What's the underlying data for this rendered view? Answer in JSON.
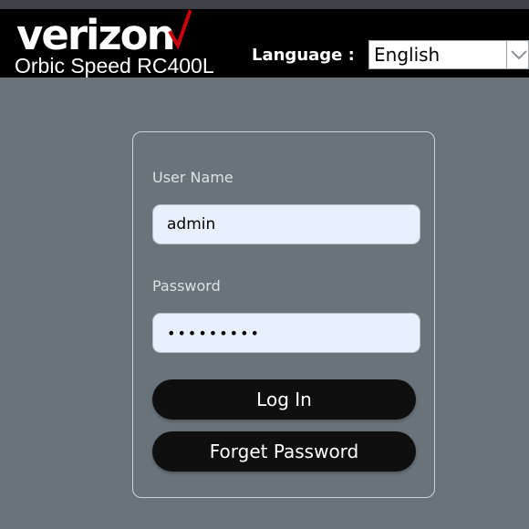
{
  "header": {
    "brand": "verizon",
    "model": "Orbic Speed RC400L",
    "language_label": "Language :",
    "language_selected": "English",
    "brand_check_color": "#cd040b"
  },
  "login": {
    "username_label": "User Name",
    "username_value": "admin",
    "password_label": "Password",
    "password_value": "•••••••••",
    "login_button": "Log In",
    "forget_button": "Forget Password"
  },
  "icons": {
    "brand_check": "checkmark-icon",
    "language_dropdown": "chevron-down-icon"
  }
}
